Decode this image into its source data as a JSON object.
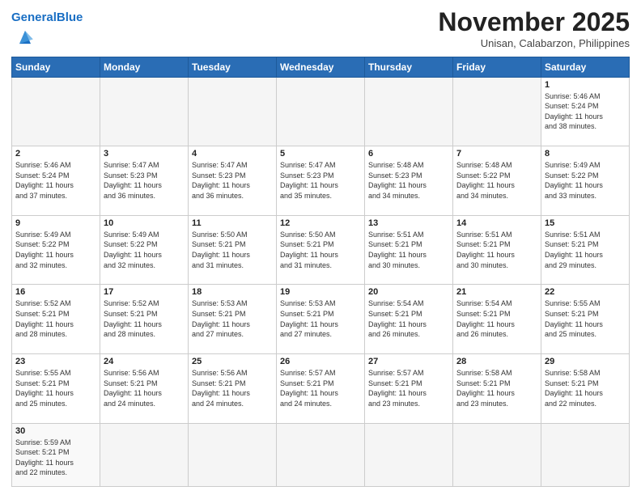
{
  "header": {
    "logo_general": "General",
    "logo_blue": "Blue",
    "month_title": "November 2025",
    "subtitle": "Unisan, Calabarzon, Philippines"
  },
  "weekdays": [
    "Sunday",
    "Monday",
    "Tuesday",
    "Wednesday",
    "Thursday",
    "Friday",
    "Saturday"
  ],
  "weeks": [
    [
      {
        "day": "",
        "info": ""
      },
      {
        "day": "",
        "info": ""
      },
      {
        "day": "",
        "info": ""
      },
      {
        "day": "",
        "info": ""
      },
      {
        "day": "",
        "info": ""
      },
      {
        "day": "",
        "info": ""
      },
      {
        "day": "1",
        "info": "Sunrise: 5:46 AM\nSunset: 5:24 PM\nDaylight: 11 hours\nand 38 minutes."
      }
    ],
    [
      {
        "day": "2",
        "info": "Sunrise: 5:46 AM\nSunset: 5:24 PM\nDaylight: 11 hours\nand 37 minutes."
      },
      {
        "day": "3",
        "info": "Sunrise: 5:47 AM\nSunset: 5:23 PM\nDaylight: 11 hours\nand 36 minutes."
      },
      {
        "day": "4",
        "info": "Sunrise: 5:47 AM\nSunset: 5:23 PM\nDaylight: 11 hours\nand 36 minutes."
      },
      {
        "day": "5",
        "info": "Sunrise: 5:47 AM\nSunset: 5:23 PM\nDaylight: 11 hours\nand 35 minutes."
      },
      {
        "day": "6",
        "info": "Sunrise: 5:48 AM\nSunset: 5:23 PM\nDaylight: 11 hours\nand 34 minutes."
      },
      {
        "day": "7",
        "info": "Sunrise: 5:48 AM\nSunset: 5:22 PM\nDaylight: 11 hours\nand 34 minutes."
      },
      {
        "day": "8",
        "info": "Sunrise: 5:49 AM\nSunset: 5:22 PM\nDaylight: 11 hours\nand 33 minutes."
      }
    ],
    [
      {
        "day": "9",
        "info": "Sunrise: 5:49 AM\nSunset: 5:22 PM\nDaylight: 11 hours\nand 32 minutes."
      },
      {
        "day": "10",
        "info": "Sunrise: 5:49 AM\nSunset: 5:22 PM\nDaylight: 11 hours\nand 32 minutes."
      },
      {
        "day": "11",
        "info": "Sunrise: 5:50 AM\nSunset: 5:21 PM\nDaylight: 11 hours\nand 31 minutes."
      },
      {
        "day": "12",
        "info": "Sunrise: 5:50 AM\nSunset: 5:21 PM\nDaylight: 11 hours\nand 31 minutes."
      },
      {
        "day": "13",
        "info": "Sunrise: 5:51 AM\nSunset: 5:21 PM\nDaylight: 11 hours\nand 30 minutes."
      },
      {
        "day": "14",
        "info": "Sunrise: 5:51 AM\nSunset: 5:21 PM\nDaylight: 11 hours\nand 30 minutes."
      },
      {
        "day": "15",
        "info": "Sunrise: 5:51 AM\nSunset: 5:21 PM\nDaylight: 11 hours\nand 29 minutes."
      }
    ],
    [
      {
        "day": "16",
        "info": "Sunrise: 5:52 AM\nSunset: 5:21 PM\nDaylight: 11 hours\nand 28 minutes."
      },
      {
        "day": "17",
        "info": "Sunrise: 5:52 AM\nSunset: 5:21 PM\nDaylight: 11 hours\nand 28 minutes."
      },
      {
        "day": "18",
        "info": "Sunrise: 5:53 AM\nSunset: 5:21 PM\nDaylight: 11 hours\nand 27 minutes."
      },
      {
        "day": "19",
        "info": "Sunrise: 5:53 AM\nSunset: 5:21 PM\nDaylight: 11 hours\nand 27 minutes."
      },
      {
        "day": "20",
        "info": "Sunrise: 5:54 AM\nSunset: 5:21 PM\nDaylight: 11 hours\nand 26 minutes."
      },
      {
        "day": "21",
        "info": "Sunrise: 5:54 AM\nSunset: 5:21 PM\nDaylight: 11 hours\nand 26 minutes."
      },
      {
        "day": "22",
        "info": "Sunrise: 5:55 AM\nSunset: 5:21 PM\nDaylight: 11 hours\nand 25 minutes."
      }
    ],
    [
      {
        "day": "23",
        "info": "Sunrise: 5:55 AM\nSunset: 5:21 PM\nDaylight: 11 hours\nand 25 minutes."
      },
      {
        "day": "24",
        "info": "Sunrise: 5:56 AM\nSunset: 5:21 PM\nDaylight: 11 hours\nand 24 minutes."
      },
      {
        "day": "25",
        "info": "Sunrise: 5:56 AM\nSunset: 5:21 PM\nDaylight: 11 hours\nand 24 minutes."
      },
      {
        "day": "26",
        "info": "Sunrise: 5:57 AM\nSunset: 5:21 PM\nDaylight: 11 hours\nand 24 minutes."
      },
      {
        "day": "27",
        "info": "Sunrise: 5:57 AM\nSunset: 5:21 PM\nDaylight: 11 hours\nand 23 minutes."
      },
      {
        "day": "28",
        "info": "Sunrise: 5:58 AM\nSunset: 5:21 PM\nDaylight: 11 hours\nand 23 minutes."
      },
      {
        "day": "29",
        "info": "Sunrise: 5:58 AM\nSunset: 5:21 PM\nDaylight: 11 hours\nand 22 minutes."
      }
    ],
    [
      {
        "day": "30",
        "info": "Sunrise: 5:59 AM\nSunset: 5:21 PM\nDaylight: 11 hours\nand 22 minutes."
      },
      {
        "day": "",
        "info": ""
      },
      {
        "day": "",
        "info": ""
      },
      {
        "day": "",
        "info": ""
      },
      {
        "day": "",
        "info": ""
      },
      {
        "day": "",
        "info": ""
      },
      {
        "day": "",
        "info": ""
      }
    ]
  ]
}
